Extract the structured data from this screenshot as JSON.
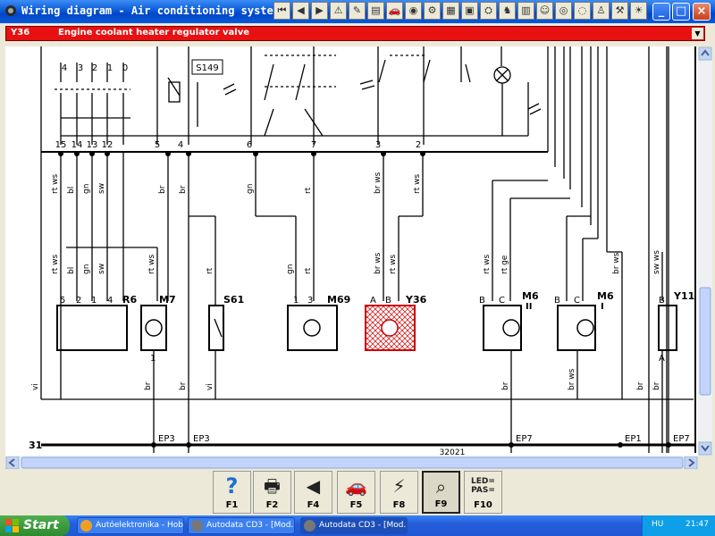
{
  "window": {
    "title": "Wiring diagram - Air conditioning system",
    "icon": "app-icon"
  },
  "toolbar": {
    "icons": [
      "first-page-icon",
      "prev-page-icon",
      "next-page-icon",
      "warning-icon",
      "tool-icon",
      "book-icon",
      "car-icon",
      "gauge-icon",
      "service-icon",
      "pages-icon",
      "parts-icon",
      "engine-icon",
      "seat-icon",
      "manual-icon",
      "face-icon",
      "tyre-icon",
      "lamp-icon",
      "person-icon",
      "tools-icon",
      "bulb-icon"
    ]
  },
  "component": {
    "code": "Y36",
    "name": "Engine coolant heater regulator valve",
    "selected_color": "#e81010"
  },
  "diagram": {
    "top_pins": [
      "4",
      "3",
      "2",
      "1",
      "0"
    ],
    "relay_label": "S149",
    "connector_pins": [
      "15",
      "14",
      "13",
      "12",
      "5",
      "4",
      "6",
      "7",
      "3",
      "2"
    ],
    "wire_colors": [
      "rt ws",
      "bl",
      "gn",
      "sw",
      "br",
      "br",
      "gn",
      "rt",
      "br ws",
      "rt ws",
      "rt ws",
      "rt ge",
      "br ws",
      "sw ws",
      "rt ws",
      "bl",
      "gn",
      "sw",
      "rt ws",
      "rt",
      "gn",
      "rt",
      "br ws",
      "rt ws"
    ],
    "components": [
      {
        "code": "R6",
        "pins": [
          "5",
          "2",
          "1",
          "4"
        ]
      },
      {
        "code": "M7",
        "pins": [
          "1"
        ]
      },
      {
        "code": "S61",
        "pins": []
      },
      {
        "code": "M69",
        "pins": [
          "1",
          "3"
        ]
      },
      {
        "code": "Y36",
        "pins": [
          "A",
          "B"
        ]
      },
      {
        "code": "M6",
        "sub": "II",
        "pins": [
          "B",
          "C"
        ]
      },
      {
        "code": "M6",
        "sub": "I",
        "pins": [
          "B",
          "C"
        ]
      },
      {
        "code": "Y11",
        "pins": [
          "B",
          "A"
        ]
      }
    ],
    "bottom_wires": [
      "vi",
      "br",
      "br",
      "vi",
      "br",
      "br ws",
      "br",
      "br"
    ],
    "ground_label": "31",
    "ground_points": [
      "EP3",
      "EP3",
      "EP7",
      "EP1",
      "EP7"
    ],
    "sheet_number": "32021",
    "highlight_color": "#e81010"
  },
  "function_keys": [
    {
      "icon": "help-icon",
      "label": "F1"
    },
    {
      "icon": "printer-icon",
      "label": "F2"
    },
    {
      "icon": "back-icon",
      "label": "F4"
    },
    {
      "icon": "car-icon",
      "label": "F5"
    },
    {
      "icon": "component-icon",
      "label": "F8"
    },
    {
      "icon": "zoom-icon",
      "label": "F9"
    },
    {
      "icon": "led-pas-icon",
      "label": "F10",
      "text": [
        "LED=",
        "PAS="
      ]
    }
  ],
  "taskbar": {
    "start_label": "Start",
    "tasks": [
      "Autóelektronika - Hob...",
      "Autodata CD3 - [Mod...",
      "Autodata CD3 - [Mod..."
    ],
    "language": "HU",
    "clock": "21:47"
  }
}
